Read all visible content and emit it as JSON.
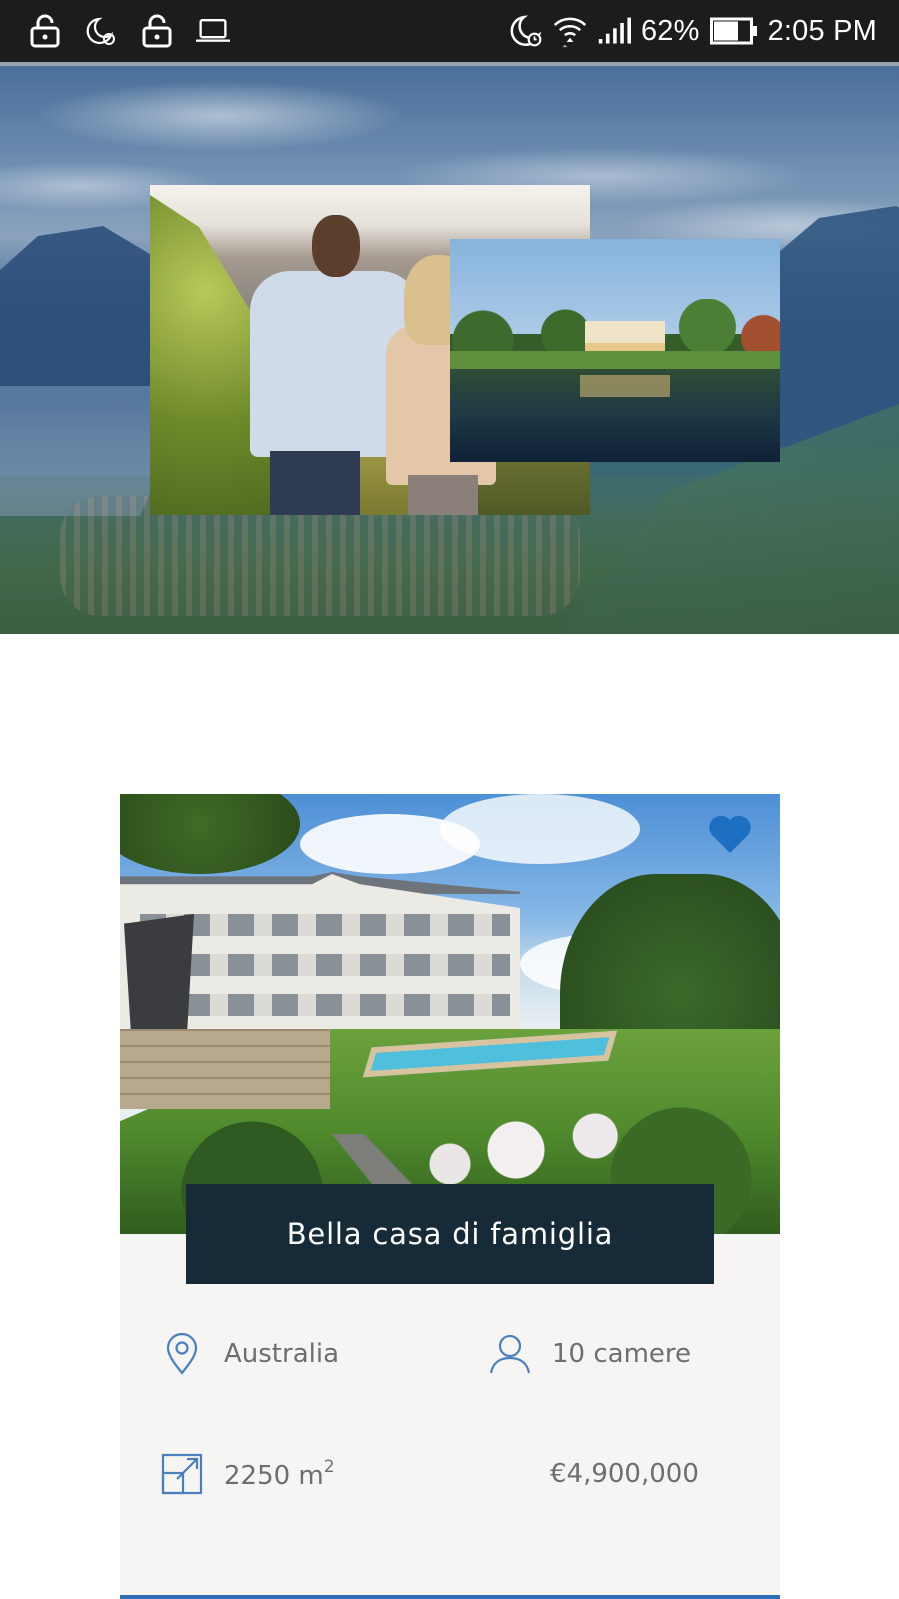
{
  "status_bar": {
    "left_icons": [
      "lock-icon",
      "moon-alarm-icon",
      "lock-icon",
      "laptop-icon"
    ],
    "right_icons": [
      "moon-alarm-icon",
      "wifi-icon",
      "signal-icon",
      "battery-icon"
    ],
    "battery": "62%",
    "time": "2:05 PM"
  },
  "hero": {
    "images": [
      "landscape-background",
      "couple-vineyard-photo",
      "villa-lake-photo"
    ]
  },
  "property": {
    "favorite_icon": "heart-icon",
    "title": "Bella casa di famiglia",
    "location": "Australia",
    "rooms": "10 camere",
    "area_value": "2250 m",
    "area_sup": "2",
    "price": "€4,900,000"
  },
  "colors": {
    "status_bar_bg": "#1c1c1c",
    "banner_bg": "#172a37",
    "accent_blue": "#2e6bb8",
    "card_bg": "#f6f5f3",
    "info_text": "#6e6e6e"
  }
}
